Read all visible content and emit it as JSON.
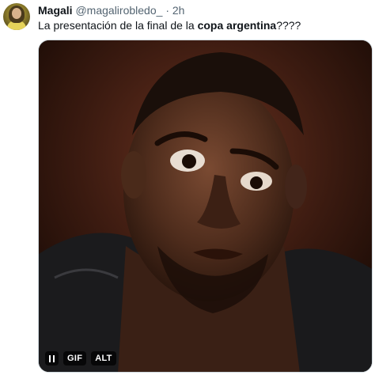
{
  "tweet": {
    "author_name": "Magali",
    "handle": "@magalirobledo_",
    "separator": "·",
    "time": "2h",
    "text_plain": "La presentación de la final de la ",
    "text_bold": "copa argentina",
    "text_suffix": "????"
  },
  "media": {
    "type_badge": "GIF",
    "alt_badge": "ALT",
    "pause_icon": "pause-icon"
  }
}
